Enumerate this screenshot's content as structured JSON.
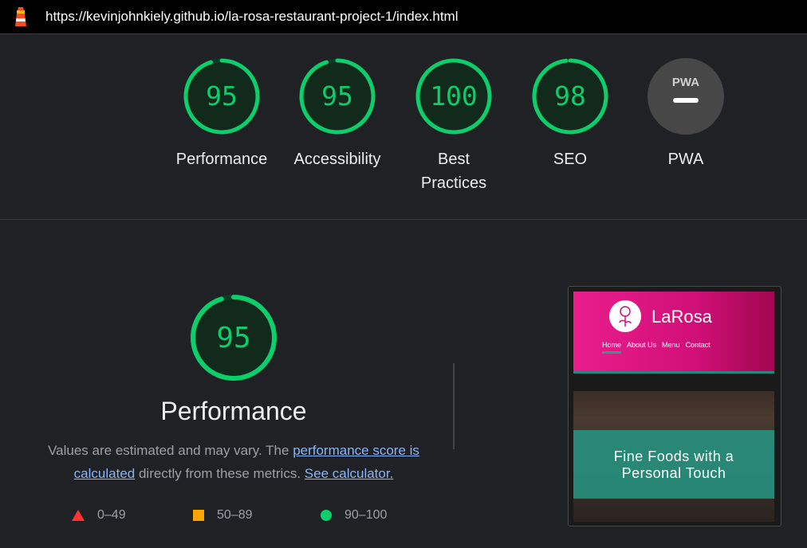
{
  "browser": {
    "url": "https://kevinjohnkiely.github.io/la-rosa-restaurant-project-1/index.html"
  },
  "categories": [
    {
      "label": "Performance",
      "score": "95"
    },
    {
      "label": "Accessibility",
      "score": "95"
    },
    {
      "label": "Best Practices",
      "score": "100"
    },
    {
      "label": "SEO",
      "score": "98"
    },
    {
      "label": "PWA",
      "badge": "PWA"
    }
  ],
  "performance": {
    "score": "95",
    "title": "Performance",
    "desc_prefix": "Values are estimated and may vary. The ",
    "score_link": "performance score is calculated",
    "desc_mid": " directly from these metrics. ",
    "calc_link": "See calculator."
  },
  "legend": [
    {
      "range": "0–49",
      "color": "#ff3333"
    },
    {
      "range": "50–89",
      "color": "#ffa400"
    },
    {
      "range": "90–100",
      "color": "#0cce6b"
    }
  ],
  "screenshot": {
    "brand": "LaRosa",
    "nav": [
      "Home",
      "About Us",
      "Menu",
      "Contact"
    ],
    "tagline_line1": "Fine Foods with a",
    "tagline_line2": "Personal Touch"
  },
  "colors": {
    "pass": "#0cce6b",
    "ring_bg": "#0b3d23",
    "pwa_bg": "#474747"
  }
}
